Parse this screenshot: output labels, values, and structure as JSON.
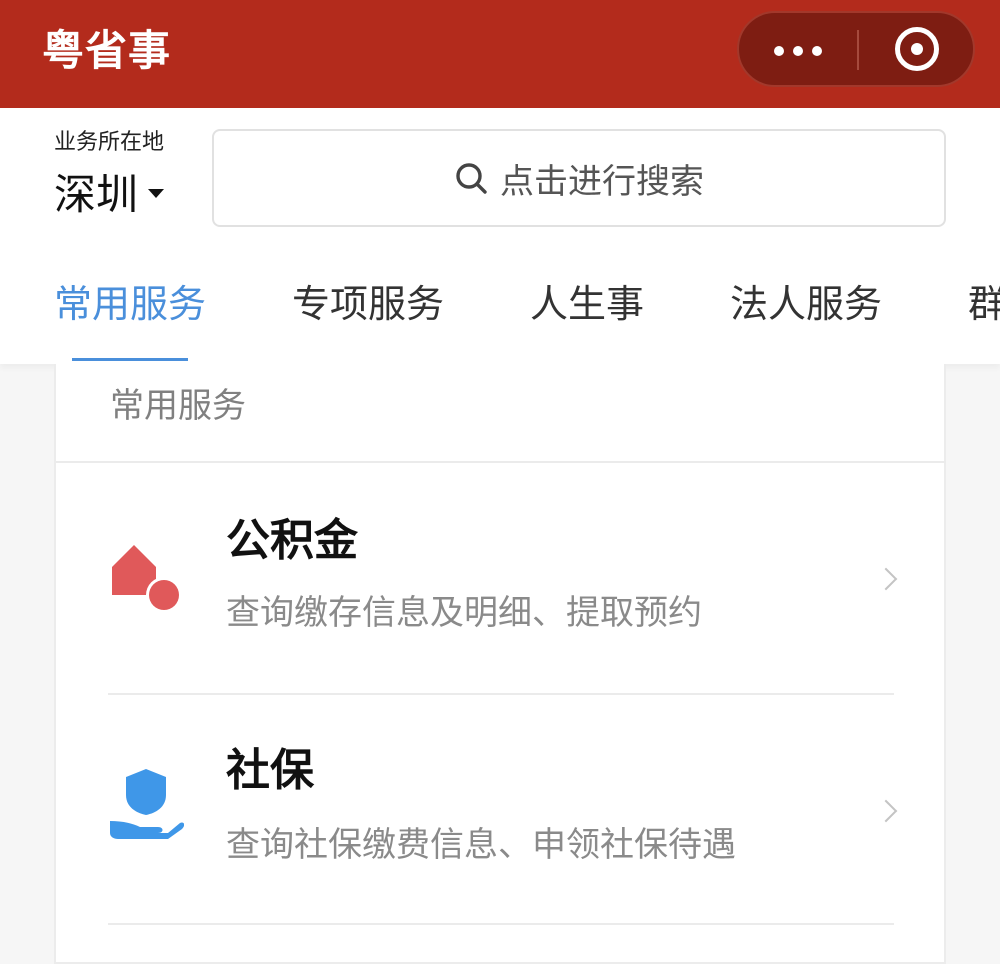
{
  "header": {
    "app_title": "粤省事",
    "more_icon": "more-dots-icon",
    "close_icon": "target-close-icon",
    "bg_color": "#b32b1c"
  },
  "location": {
    "label": "业务所在地",
    "value": "深圳"
  },
  "search": {
    "placeholder": "点击进行搜索",
    "icon": "search-icon"
  },
  "tabs": [
    {
      "label": "常用服务",
      "active": true
    },
    {
      "label": "专项服务",
      "active": false
    },
    {
      "label": "人生事",
      "active": false
    },
    {
      "label": "法人服务",
      "active": false
    },
    {
      "label": "群",
      "active": false
    }
  ],
  "accent_color": "#4a8fdb",
  "section": {
    "title": "常用服务",
    "services": [
      {
        "name": "公积金",
        "desc": "查询缴存信息及明细、提取预约",
        "icon": "house-icon",
        "icon_color": "#e0595a"
      },
      {
        "name": "社保",
        "desc": "查询社保缴费信息、申领社保待遇",
        "icon": "shield-hand-icon",
        "icon_color": "#3f97e8"
      }
    ]
  }
}
